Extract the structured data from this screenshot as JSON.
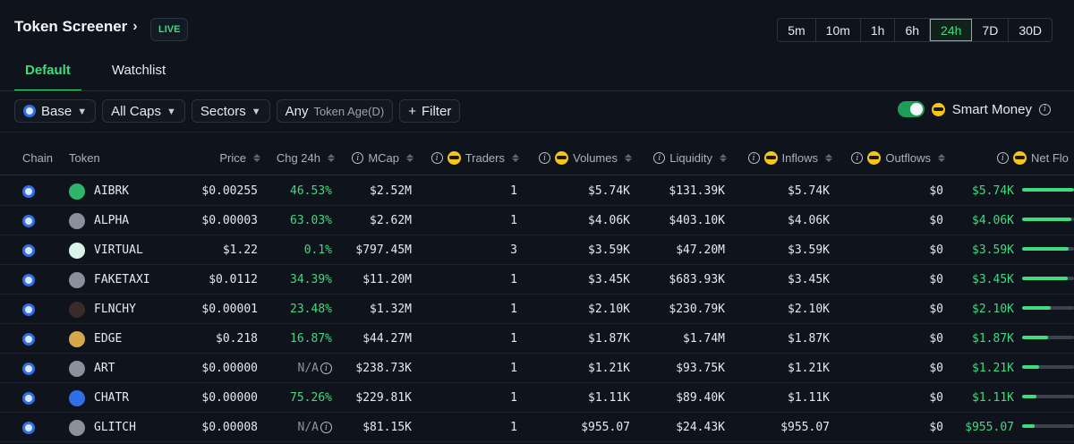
{
  "header": {
    "title": "Token Screener",
    "live_badge": "LIVE",
    "time_ranges": [
      "5m",
      "10m",
      "1h",
      "6h",
      "24h",
      "7D",
      "30D"
    ],
    "active_time_range": "24h"
  },
  "tabs": [
    {
      "label": "Default",
      "active": true
    },
    {
      "label": "Watchlist",
      "active": false
    }
  ],
  "filters": {
    "chain": "Base",
    "caps": "All Caps",
    "sectors": "Sectors",
    "token_age_value": "Any",
    "token_age_label": "Token Age(D)",
    "add_filter": "Filter",
    "smart_money_label": "Smart Money",
    "smart_money_enabled": true
  },
  "columns": {
    "chain": "Chain",
    "token": "Token",
    "price": "Price",
    "chg": "Chg 24h",
    "mcap": "MCap",
    "traders": "Traders",
    "volumes": "Volumes",
    "liquidity": "Liquidity",
    "inflows": "Inflows",
    "outflows": "Outflows",
    "netflow": "Net Flo"
  },
  "rows": [
    {
      "token": "AIBRK",
      "price": "$0.00255",
      "chg": "46.53%",
      "mcap": "$2.52M",
      "traders": "1",
      "volumes": "$5.74K",
      "liquidity": "$131.39K",
      "inflows": "$5.74K",
      "outflows": "$0",
      "netflow": "$5.74K",
      "net_bar": 1.0,
      "icon_color": "#2fb56a"
    },
    {
      "token": "ALPHA",
      "price": "$0.00003",
      "chg": "63.03%",
      "mcap": "$2.62M",
      "traders": "1",
      "volumes": "$4.06K",
      "liquidity": "$403.10K",
      "inflows": "$4.06K",
      "outflows": "$0",
      "netflow": "$4.06K",
      "net_bar": 0.95,
      "icon_color": "#8a919c"
    },
    {
      "token": "VIRTUAL",
      "price": "$1.22",
      "chg": "0.1%",
      "mcap": "$797.45M",
      "traders": "3",
      "volumes": "$3.59K",
      "liquidity": "$47.20M",
      "inflows": "$3.59K",
      "outflows": "$0",
      "netflow": "$3.59K",
      "net_bar": 0.9,
      "icon_color": "#d9f3ea"
    },
    {
      "token": "FAKETAXI",
      "price": "$0.0112",
      "chg": "34.39%",
      "mcap": "$11.20M",
      "traders": "1",
      "volumes": "$3.45K",
      "liquidity": "$683.93K",
      "inflows": "$3.45K",
      "outflows": "$0",
      "netflow": "$3.45K",
      "net_bar": 0.88,
      "icon_color": "#8a919c"
    },
    {
      "token": "FLNCHY",
      "price": "$0.00001",
      "chg": "23.48%",
      "mcap": "$1.32M",
      "traders": "1",
      "volumes": "$2.10K",
      "liquidity": "$230.79K",
      "inflows": "$2.10K",
      "outflows": "$0",
      "netflow": "$2.10K",
      "net_bar": 0.55,
      "icon_color": "#3a2a2a"
    },
    {
      "token": "EDGE",
      "price": "$0.218",
      "chg": "16.87%",
      "mcap": "$44.27M",
      "traders": "1",
      "volumes": "$1.87K",
      "liquidity": "$1.74M",
      "inflows": "$1.87K",
      "outflows": "$0",
      "netflow": "$1.87K",
      "net_bar": 0.5,
      "icon_color": "#d6a84a"
    },
    {
      "token": "ART",
      "price": "$0.00000",
      "chg": "N/A",
      "mcap": "$238.73K",
      "traders": "1",
      "volumes": "$1.21K",
      "liquidity": "$93.75K",
      "inflows": "$1.21K",
      "outflows": "$0",
      "netflow": "$1.21K",
      "net_bar": 0.32,
      "icon_color": "#8a919c"
    },
    {
      "token": "CHATR",
      "price": "$0.00000",
      "chg": "75.26%",
      "mcap": "$229.81K",
      "traders": "1",
      "volumes": "$1.11K",
      "liquidity": "$89.40K",
      "inflows": "$1.11K",
      "outflows": "$0",
      "netflow": "$1.11K",
      "net_bar": 0.28,
      "icon_color": "#2f6fe8"
    },
    {
      "token": "GLITCH",
      "price": "$0.00008",
      "chg": "N/A",
      "mcap": "$81.15K",
      "traders": "1",
      "volumes": "$955.07",
      "liquidity": "$24.43K",
      "inflows": "$955.07",
      "outflows": "$0",
      "netflow": "$955.07",
      "net_bar": 0.24,
      "icon_color": "#8a919c"
    }
  ],
  "colors": {
    "accent": "#3fdc7e",
    "background": "#0f141c",
    "chain_base": "#2f6fe8"
  }
}
